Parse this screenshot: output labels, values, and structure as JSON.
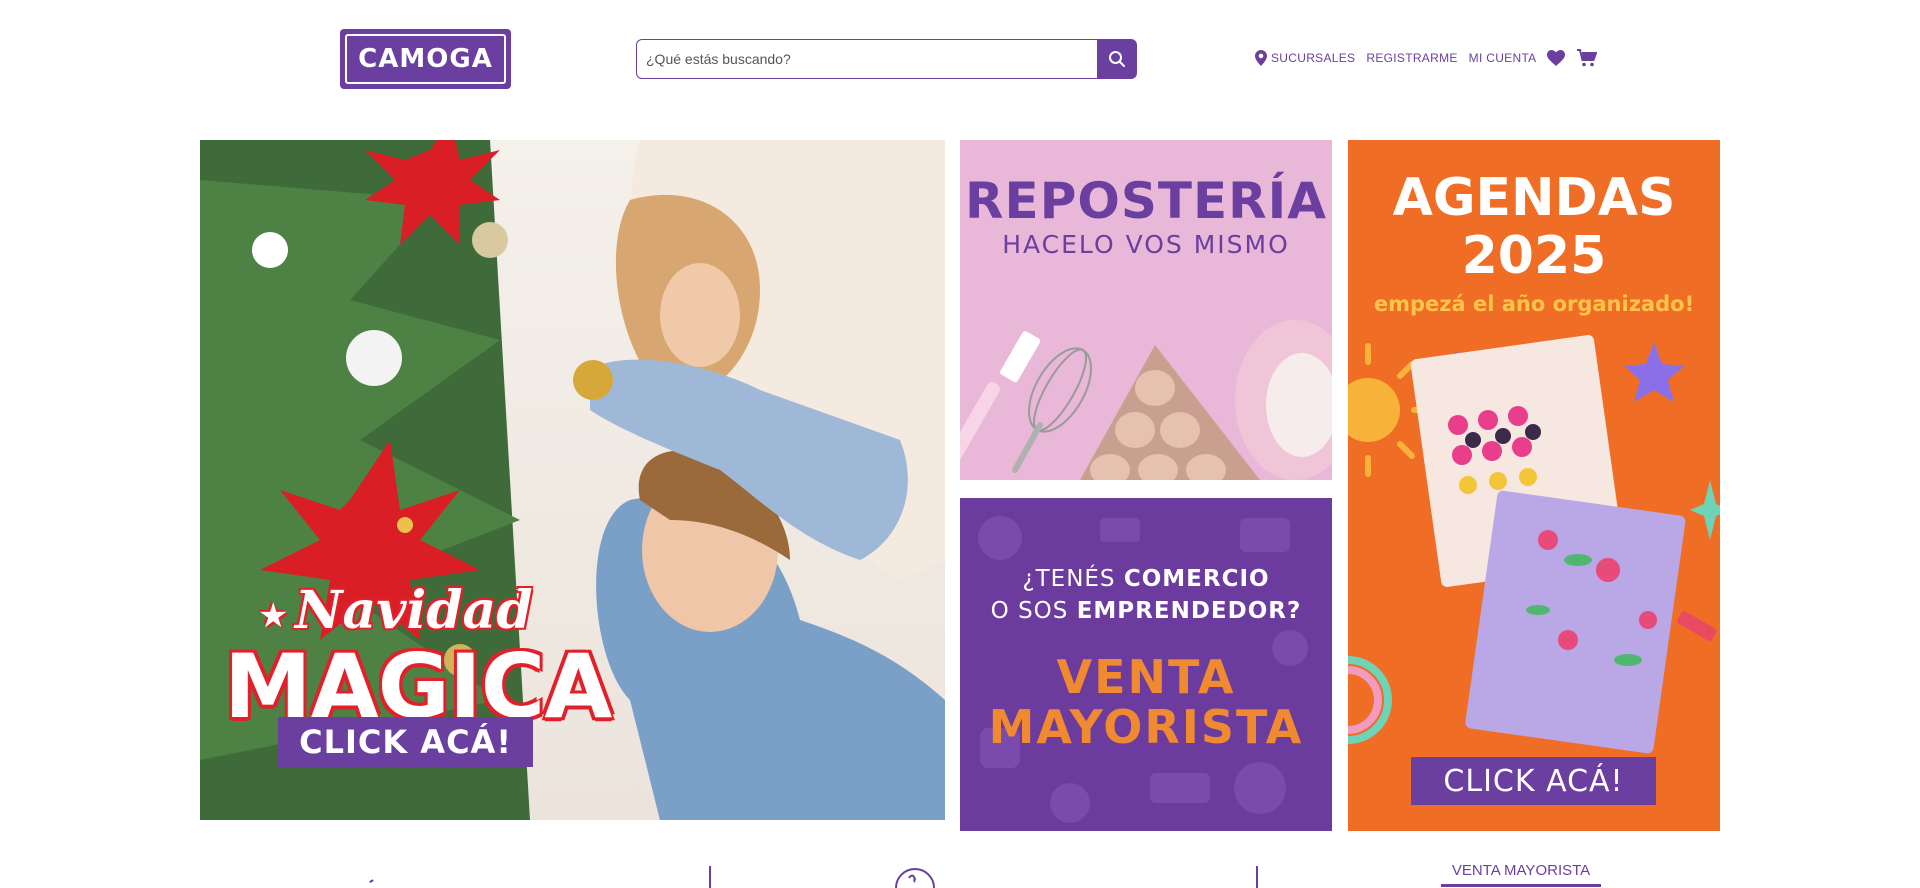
{
  "brand": {
    "logo_text": "CAMOGA",
    "accent": "#6b3fa0"
  },
  "search": {
    "placeholder": "¿Qué estás buscando?",
    "value": "",
    "icon": "search-icon"
  },
  "topnav": {
    "sucursales": "SUCURSALES",
    "registrarme": "REGISTRARME",
    "mi_cuenta": "MI CUENTA",
    "icons": [
      "location-pin-icon",
      "heart-icon",
      "cart-icon"
    ]
  },
  "banners": {
    "navidad": {
      "script": "Navidad",
      "big": "MAGICA",
      "cta": "CLICK ACÁ!"
    },
    "reposteria": {
      "title": "REPOSTERÍA",
      "subtitle": "HACELO VOS MISMO"
    },
    "venta": {
      "q1_pre": "¿TENÉS ",
      "q1_bold": "COMERCIO",
      "q2_pre": "O SOS ",
      "q2_bold": "EMPRENDEDOR?",
      "big1": "VENTA",
      "big2": "MAYORISTA"
    },
    "agendas": {
      "title1": "AGENDAS",
      "title2": "2025",
      "subtitle": "empezá el año organizado!",
      "cta": "CLICK ACÁ!"
    }
  },
  "bottom": {
    "tab_label": "VENTA MAYORISTA"
  },
  "colors": {
    "purple": "#6b3fa0",
    "orange": "#ef6d25",
    "pink": "#e9b7d7",
    "red": "#e2202a"
  }
}
